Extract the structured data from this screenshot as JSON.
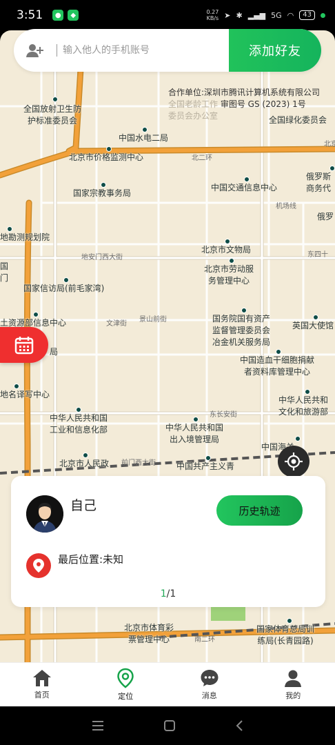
{
  "status_bar": {
    "time": "3:51",
    "net_speed_value": "0.27",
    "net_speed_unit": "KB/s",
    "network": "5G",
    "battery": "43"
  },
  "search": {
    "placeholder": "输入他人的手机账号",
    "add_friend_label": "添加好友",
    "add_icon": "add-user-icon"
  },
  "map": {
    "copyright_line1": "合作单位:深圳市腾讯计算机系统有限公司",
    "copyright_line2": "审图号 GS (2023) 1号",
    "faded_line1": "全国老龄工作",
    "faded_line2": "委员会办公室",
    "pois": [
      {
        "name": "全国放射卫生防\n护标准委员会"
      },
      {
        "name": "中国水电二局"
      },
      {
        "name": "北京市价格监测中心"
      },
      {
        "name": "国家宗教事务局"
      },
      {
        "name": "中国交通信息中心"
      },
      {
        "name": "俄罗斯\n商务代"
      },
      {
        "name": "俄罗"
      },
      {
        "name": "全国绿化委员会"
      },
      {
        "name": "地勘测规划院"
      },
      {
        "name": "北京市文物局"
      },
      {
        "name": "北京市劳动服\n务管理中心"
      },
      {
        "name": "国家信访局(前毛家湾)"
      },
      {
        "name": "国\n门"
      },
      {
        "name": "土资源部信息中心"
      },
      {
        "name": "国务院国有资产\n监督管理委员会\n冶金机关服务局"
      },
      {
        "name": "英国大使馆"
      },
      {
        "name": "中国造血干细胞捐献\n者资料库管理中心"
      },
      {
        "name": "局"
      },
      {
        "name": "地名译写中心"
      },
      {
        "name": "中华人民共和国\n工业和信息化部"
      },
      {
        "name": "中华人民共和国\n出入境管理局"
      },
      {
        "name": "中华人民共和\n文化和旅游部"
      },
      {
        "name": "中国海关"
      },
      {
        "name": "北京市人民政"
      },
      {
        "name": "中国共产主义青"
      },
      {
        "name": "北京市体育彩\n票管理中心"
      },
      {
        "name": "国家体育总局训\n练局(长青园路)"
      }
    ],
    "roads": [
      "北二环",
      "机场线",
      "地安门西大街",
      "文津街",
      "景山前街",
      "东四十",
      "东长安街",
      "前门西大街",
      "南二环",
      "北京"
    ]
  },
  "locate_icon": "locate-icon",
  "calendar_icon": "calendar-icon",
  "card": {
    "member_name": "自己",
    "history_label": "历史轨迹",
    "last_location": "最后位置:未知",
    "pager_current": "1",
    "pager_total": "/1"
  },
  "tabs": [
    {
      "label": "首页",
      "icon": "home-icon"
    },
    {
      "label": "定位",
      "icon": "location-pin-icon",
      "active": true
    },
    {
      "label": "消息",
      "icon": "message-icon"
    },
    {
      "label": "我的",
      "icon": "user-icon"
    }
  ],
  "colors": {
    "accent": "#22c55e",
    "danger": "#e5322d",
    "map_bg": "#f3ebd8",
    "road_major": "#f2a13a"
  }
}
